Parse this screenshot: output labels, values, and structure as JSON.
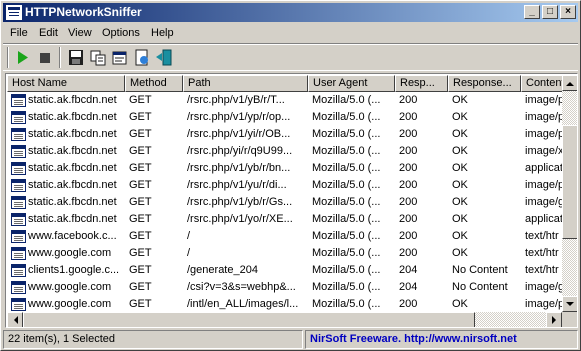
{
  "window": {
    "title": "HTTPNetworkSniffer",
    "minimize_glyph": "_",
    "maximize_glyph": "□",
    "close_glyph": "×"
  },
  "menu": [
    "File",
    "Edit",
    "View",
    "Options",
    "Help"
  ],
  "toolbar": {
    "items": [
      {
        "name": "start-capture-button",
        "icon": "play-icon"
      },
      {
        "name": "stop-capture-button",
        "icon": "stop-icon"
      },
      {
        "name": "save-button",
        "icon": "floppy-disk-icon"
      },
      {
        "name": "copy-button",
        "icon": "copy-icon"
      },
      {
        "name": "properties-button",
        "icon": "properties-icon"
      },
      {
        "name": "html-report-button",
        "icon": "html-report-icon"
      },
      {
        "name": "exit-button",
        "icon": "exit-icon"
      }
    ],
    "colors": {
      "play": "#1aa51a",
      "stop": "#404040"
    }
  },
  "table": {
    "columns": [
      "Host Name",
      "Method",
      "Path",
      "User Agent",
      "Resp...",
      "Response...",
      "Content"
    ],
    "rows": [
      [
        "static.ak.fbcdn.net",
        "GET",
        "/rsrc.php/v1/yB/r/T...",
        "Mozilla/5.0 (...",
        "200",
        "OK",
        "image/p"
      ],
      [
        "static.ak.fbcdn.net",
        "GET",
        "/rsrc.php/v1/yp/r/op...",
        "Mozilla/5.0 (...",
        "200",
        "OK",
        "image/p"
      ],
      [
        "static.ak.fbcdn.net",
        "GET",
        "/rsrc.php/v1/yi/r/OB...",
        "Mozilla/5.0 (...",
        "200",
        "OK",
        "image/p"
      ],
      [
        "static.ak.fbcdn.net",
        "GET",
        "/rsrc.php/yi/r/q9U99...",
        "Mozilla/5.0 (...",
        "200",
        "OK",
        "image/x"
      ],
      [
        "static.ak.fbcdn.net",
        "GET",
        "/rsrc.php/v1/yb/r/bn...",
        "Mozilla/5.0 (...",
        "200",
        "OK",
        "applicat"
      ],
      [
        "static.ak.fbcdn.net",
        "GET",
        "/rsrc.php/v1/yu/r/di...",
        "Mozilla/5.0 (...",
        "200",
        "OK",
        "image/p"
      ],
      [
        "static.ak.fbcdn.net",
        "GET",
        "/rsrc.php/v1/yb/r/Gs...",
        "Mozilla/5.0 (...",
        "200",
        "OK",
        "image/g"
      ],
      [
        "static.ak.fbcdn.net",
        "GET",
        "/rsrc.php/v1/yo/r/XE...",
        "Mozilla/5.0 (...",
        "200",
        "OK",
        "applicat"
      ],
      [
        "www.facebook.c...",
        "GET",
        "/",
        "Mozilla/5.0 (...",
        "200",
        "OK",
        "text/htr"
      ],
      [
        "www.google.com",
        "GET",
        "/",
        "Mozilla/5.0 (...",
        "200",
        "OK",
        "text/htr"
      ],
      [
        "clients1.google.c...",
        "GET",
        "/generate_204",
        "Mozilla/5.0 (...",
        "204",
        "No Content",
        "text/htr"
      ],
      [
        "www.google.com",
        "GET",
        "/csi?v=3&s=webhp&...",
        "Mozilla/5.0 (...",
        "204",
        "No Content",
        "image/g"
      ],
      [
        "www.google.com",
        "GET",
        "/intl/en_ALL/images/l...",
        "Mozilla/5.0 (...",
        "200",
        "OK",
        "image/p"
      ]
    ]
  },
  "status": {
    "count": "22 item(s), 1 Selected",
    "credit": "NirSoft Freeware.  http://www.nirsoft.net"
  }
}
